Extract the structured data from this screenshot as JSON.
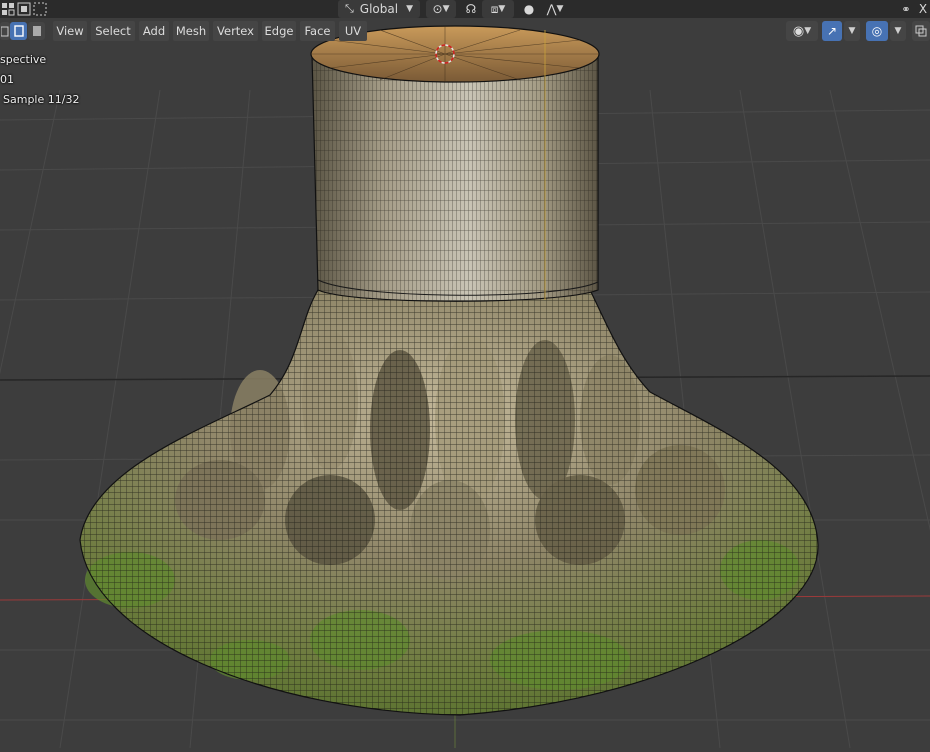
{
  "header": {
    "transform_orientation": "Global",
    "close_symbol": "X"
  },
  "menu": {
    "items": [
      "View",
      "Select",
      "Add",
      "Mesh",
      "Vertex",
      "Edge",
      "Face",
      "UV"
    ]
  },
  "overlay": {
    "line1": "spective",
    "line2": "01",
    "line3": "Sample 11/32"
  },
  "colors": {
    "viewport_bg": "#3d3d3d",
    "header_bg": "#2b2b2b",
    "menu_bg": "#454545",
    "accent_blue": "#4772b3",
    "x_axis": "#9c3a3a"
  },
  "icons": [
    "vertex-select-icon",
    "edge-select-icon",
    "face-select-icon",
    "transform-orientation-icon",
    "pivot-icon",
    "snap-icon",
    "snap-target-icon",
    "proportional-edit-icon",
    "falloff-icon",
    "visibility-icon",
    "gizmo-icon",
    "overlay-icon",
    "xray-icon",
    "close-icon"
  ]
}
